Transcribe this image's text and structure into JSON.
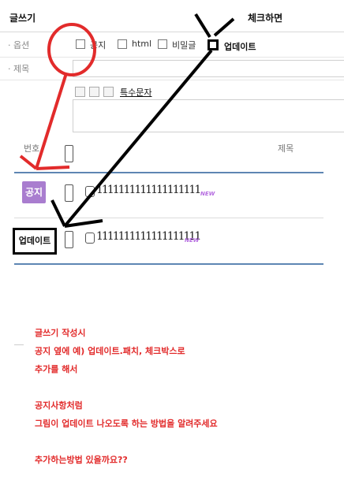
{
  "header": {
    "title": "글쓰기",
    "annotation_top": "체크하면"
  },
  "form": {
    "options_label": "· 옵션",
    "options": [
      "공지",
      "html",
      "비밀글",
      "업데이트"
    ],
    "subject_label": "· 제목",
    "special_chars": "특수문자"
  },
  "list": {
    "col_number": "번호",
    "col_subject": "제목",
    "rows": [
      {
        "badge": "공지",
        "subject": "1111111111111111111",
        "new": "NEW"
      },
      {
        "badge": "업데이트",
        "subject": "1111111111111111111",
        "new": "NEW"
      }
    ]
  },
  "question": {
    "lines": [
      "글쓰기 작성시",
      "공지 옆에 예) 업데이트.패치, 체크박스로",
      "추가를 해서",
      "",
      "공지사항처럼",
      "그림이 업데이트 나오도록 하는 방법을 알려주세요",
      "",
      "추가하는방법 있을까요??"
    ]
  },
  "colors": {
    "annotation_red": "#e22b2b",
    "badge_purple": "#a97dcf",
    "list_border": "#5e86b3"
  }
}
